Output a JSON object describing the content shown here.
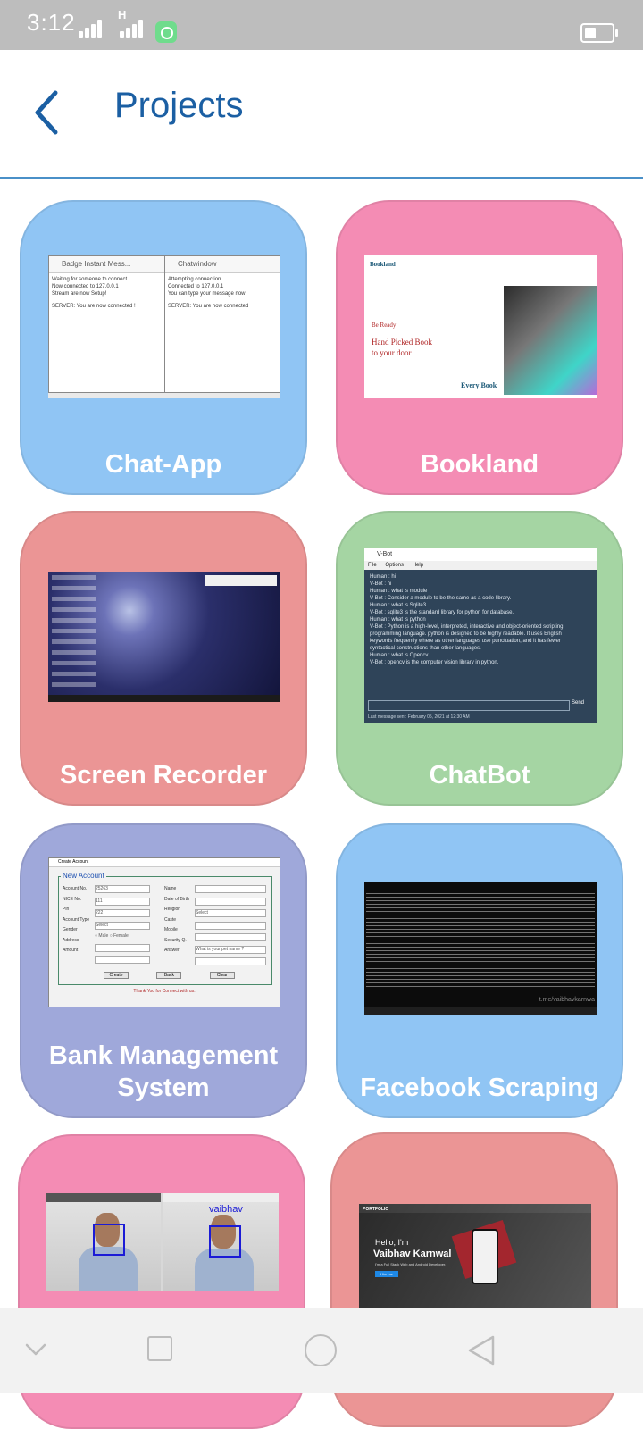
{
  "status": {
    "time": "3:12",
    "network": "H"
  },
  "header": {
    "title": "Projects"
  },
  "colors": {
    "blue": "#90c5f4",
    "pink": "#f48cb4",
    "salmon": "#eb9595",
    "green": "#a5d5a3",
    "lavender": "#9fa8da",
    "title": "#1b5fa3"
  },
  "projects": [
    {
      "label": "Chat-App"
    },
    {
      "label": "Bookland"
    },
    {
      "label": "Screen Recorder"
    },
    {
      "label": "ChatBot"
    },
    {
      "label": "Bank Management System"
    },
    {
      "label": "Facebook Scraping"
    },
    {
      "label": ""
    },
    {
      "label": ""
    }
  ],
  "shots": {
    "chat": {
      "left_title": "Badge Instant Mess...",
      "right_title": "Chatwindow",
      "left_lines": [
        "Waiting for someone to connect...",
        "Now connected to 127.0.0.1",
        "Stream are now Setup!",
        "SERVER: You are now connected !"
      ],
      "right_lines": [
        "Attempting connection...",
        "Connected to 127.0.0.1",
        "You can type your message now!",
        "SERVER: You are now connected"
      ]
    },
    "bookland": {
      "brand": "Bookland",
      "be_ready": "Be Ready",
      "headline1": "Hand Picked Book",
      "headline2": "to your door",
      "every_book": "Every Book"
    },
    "chatbot": {
      "title": "V-Bot",
      "menu": [
        "File",
        "Options",
        "Help"
      ],
      "lines": [
        "Human : hi",
        "V-Bot : hi",
        "Human : what is module",
        "V-Bot : Consider a module to be the same as a code library.",
        "Human : what is Sqlite3",
        "V-Bot : sqlite3 is the standard library for python for database.",
        "Human : what is python",
        "V-Bot : Python is a high-level, interpreted, interactive and object-oriented scripting programming language. python is designed to be highly readable. It uses English keywords frequently where as other languages use punctuation, and it has fewer syntactical constructions than other languages.",
        "Human : what is Opencv",
        "V-Bot : opencv is the computer vision library in python."
      ],
      "send": "Send",
      "footer": "Last message sent: February 05, 2021 at 12:30 AM"
    },
    "bank": {
      "title": "Create Account",
      "legend": "New Account",
      "fields_left": [
        "Account No.",
        "NICE No.",
        "Pin",
        "Account Type",
        "Gender",
        "Address",
        "Amount"
      ],
      "fields_right": [
        "Name",
        "Date of Birth",
        "Religion",
        "Caste",
        "Mobile",
        "Security Q.",
        "Answer"
      ],
      "values": {
        "account_no": "25263",
        "nice_no": "111",
        "pin": "222",
        "account_type": "Select",
        "religion": "Select",
        "security_q": "What is your pet name ?"
      },
      "gender_options": [
        "Male",
        "Female"
      ],
      "buttons": [
        "Create",
        "Back",
        "Clear"
      ],
      "footer": "Thank You for Connect with us."
    },
    "scraping": {
      "watermark": "t.me/vaibhavkarnwa"
    },
    "face": {
      "name_tag": "vaibhav"
    },
    "portfolio": {
      "brand": "PORTFOLIO",
      "hello": "Hello, I'm",
      "name": "Vaibhav Karnwal",
      "subtitle": "I'm a Full Stack Web and Android Developer.",
      "cta": "Hire me"
    }
  }
}
